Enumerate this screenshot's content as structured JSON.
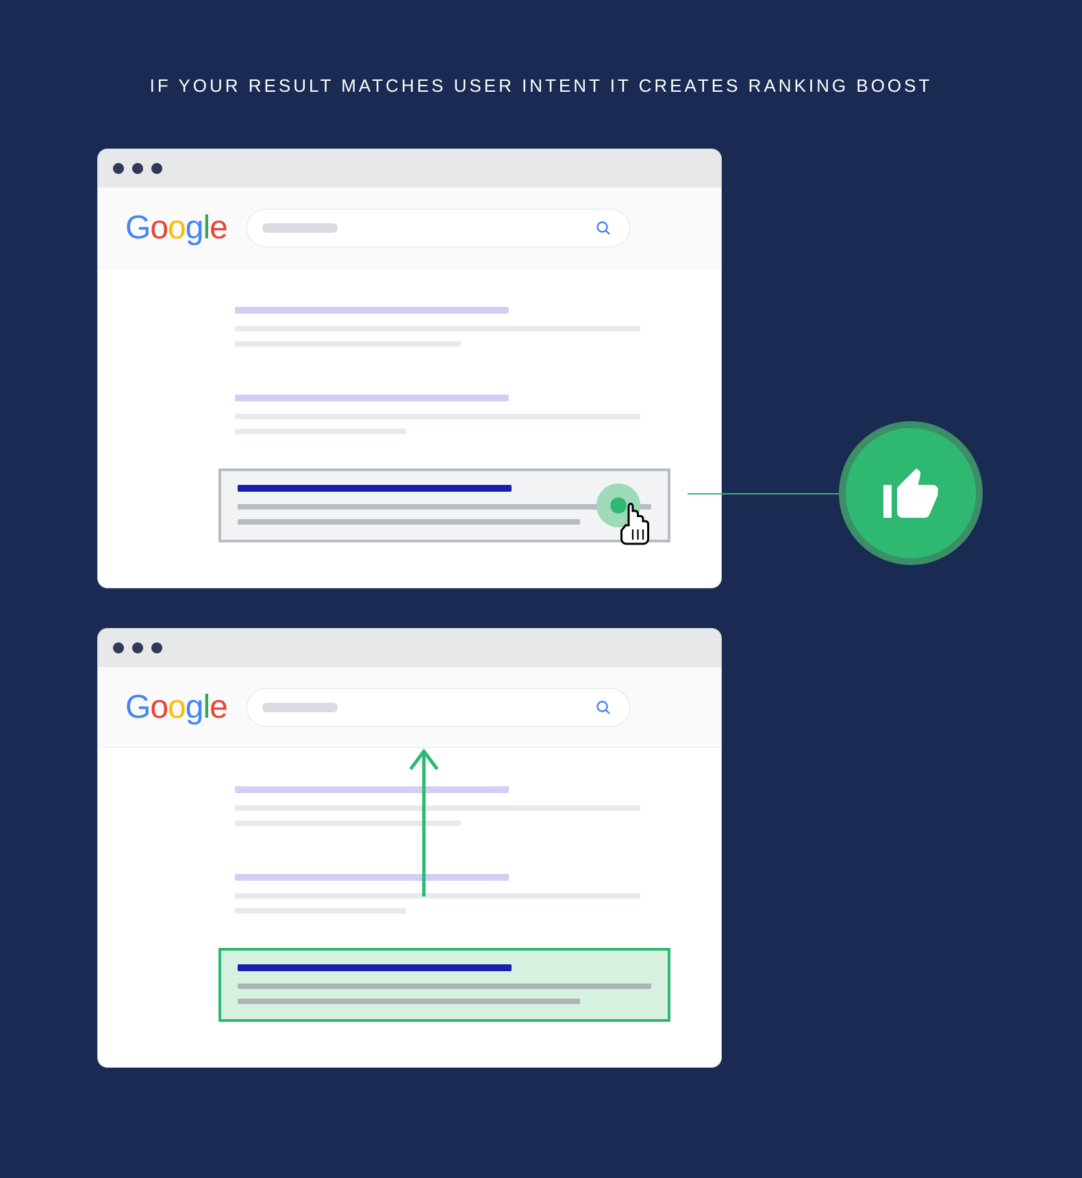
{
  "heading": "IF YOUR RESULT MATCHES USER INTENT IT CREATES RANKING BOOST",
  "logo": {
    "g1": "G",
    "o1": "o",
    "o2": "o",
    "g2": "g",
    "l": "l",
    "e": "e"
  },
  "colors": {
    "background": "#1a2a52",
    "accent_green": "#2fb872",
    "link_blue": "#1a1fb0",
    "google_blue": "#4285F4",
    "google_red": "#EA4335",
    "google_yellow": "#FBBC05",
    "google_green": "#34A853"
  },
  "icons": {
    "search": "search-icon",
    "thumbs_up": "thumbs-up-icon",
    "cursor": "pointer-cursor-icon",
    "arrow_up": "arrow-up-icon"
  }
}
